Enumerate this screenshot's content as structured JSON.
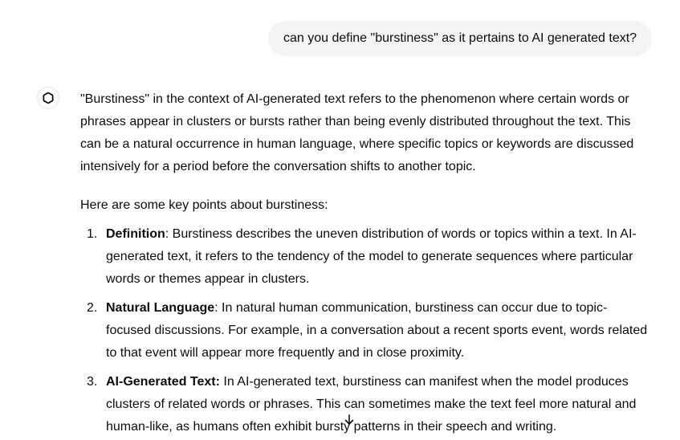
{
  "user_message": {
    "text": "can you define \"burstiness\" as it pertains to AI generated text?"
  },
  "assistant": {
    "avatar_icon": "openai-logo-icon",
    "paragraph_1": "\"Burstiness\" in the context of AI-generated text refers to the phenomenon where certain words or phrases appear in clusters or bursts rather than being evenly distributed throughout the text. This can be a natural occurrence in human language, where specific topics or keywords are discussed intensively for a period before the conversation shifts to another topic.",
    "paragraph_2": "Here are some key points about burstiness:",
    "points": [
      {
        "number": "1.",
        "title": "Definition",
        "body": ": Burstiness describes the uneven distribution of words or topics within a text. In AI-generated text, it refers to the tendency of the model to generate sequences where particular words or themes appear in clusters."
      },
      {
        "number": "2.",
        "title": "Natural Language",
        "body": ": In natural human communication, burstiness can occur due to topic-focused discussions. For example, in a conversation about a recent sports event, words related to that event will appear more frequently and in close proximity."
      },
      {
        "number": "3.",
        "title": "AI-Generated Text:",
        "body": " In AI-generated text, burstiness can manifest when the model produces clusters of related words or phrases. This can sometimes make the text feel more natural and human-like, as humans often exhibit bursty patterns in their speech and writing."
      }
    ]
  },
  "scroll_button": {
    "icon": "arrow-down-icon"
  }
}
